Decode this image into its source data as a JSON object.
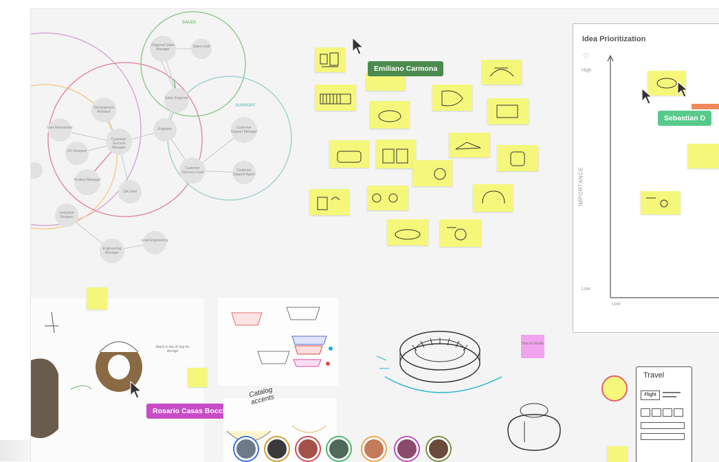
{
  "board": {
    "cursors": {
      "emiliano": {
        "name": "Emiliano Carmona",
        "color": "#4c8b4f"
      },
      "sebastian": {
        "name": "Sebastian D",
        "color": "#57c98a"
      },
      "rosario": {
        "name": "Rosario Casas Bocci",
        "color": "#c74cc5"
      }
    },
    "mindmap": {
      "groups": {
        "sales": "SALES",
        "support": "SUPPORT"
      },
      "nodes": [
        "Regional Sales Manager",
        "Sales Lead",
        "Sales Engineer",
        "Development Architect",
        "User Researcher",
        "UX Designer",
        "Customer Success Manager",
        "Engineer",
        "Customer Support Manager",
        "Product Manager",
        "QA Lead",
        "Customer Success Lead",
        "Customer Support Agent",
        "Industrial Designer",
        "Engineering Manager",
        "Lead Engineering"
      ]
    },
    "prioritization": {
      "title": "Idea Prioritization",
      "y_axis": "IMPORTANCE",
      "high": "High",
      "low_y": "Low",
      "low_x": "Low"
    },
    "sketch_notes": {
      "catalog_note": "Catalog accents",
      "pink_note": "How to handle",
      "wrap_text": "Stack to top of ring for storage",
      "travel": {
        "title": "Travel",
        "button": "Flight"
      }
    },
    "colors": {
      "sticky": "#f5f77a",
      "canvas": "#f4f4f4",
      "purple_circle": "#c98ac9",
      "red_circle": "#d9607a",
      "green_circle": "#79b979",
      "teal_circle": "#7fc7c2",
      "orange_circle": "#f0c37a"
    },
    "avatars": [
      {
        "name": "avatar-1",
        "ring": "#3d6fd6"
      },
      {
        "name": "avatar-2",
        "ring": "#c89b30"
      },
      {
        "name": "avatar-3",
        "ring": "#d14a4a"
      },
      {
        "name": "avatar-4",
        "ring": "#49b36b"
      },
      {
        "name": "avatar-5",
        "ring": "#e9a34d"
      },
      {
        "name": "avatar-6",
        "ring": "#b64cb8"
      },
      {
        "name": "avatar-7",
        "ring": "#7a8a3a"
      }
    ]
  }
}
